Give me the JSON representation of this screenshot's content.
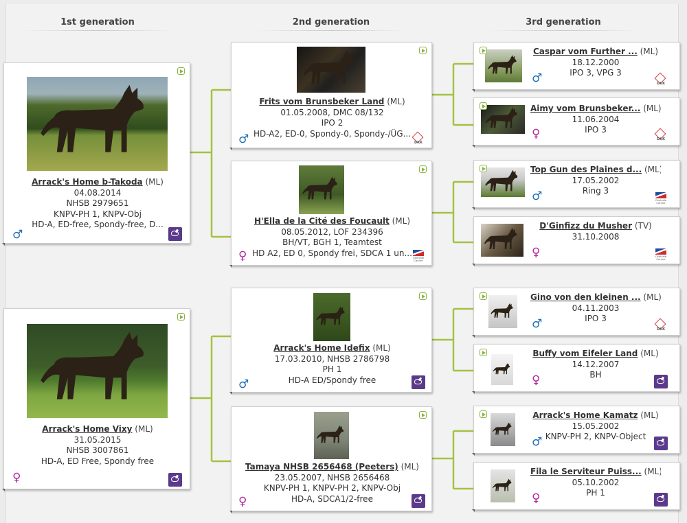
{
  "headers": {
    "gen1": "1st generation",
    "gen2": "2nd generation",
    "gen3": "3rd generation"
  },
  "colors": {
    "connector": "#a3c241",
    "male": "#1d6fb8",
    "female": "#b3269e",
    "knpv_logo": "#5b3a8c"
  },
  "dogs": {
    "g1_0": {
      "name": "Arrack's Home b-Takoda",
      "reg": "(ML)",
      "lines": [
        "04.08.2014",
        "NHSB 2979651",
        "KNPV-PH 1, KNPV-Obj",
        "HD-A, ED-free, Spondy-free, D..."
      ],
      "sex": "male",
      "sex_symbol": "♂",
      "logo": "knpv-logo-icon",
      "photo": "dog-standing-field-photo"
    },
    "g1_1": {
      "name": "Arrack's Home Vixy",
      "reg": "(ML)",
      "lines": [
        "31.05.2015",
        "NHSB 3007861",
        "HD-A, ED Free, Spondy free"
      ],
      "sex": "female",
      "sex_symbol": "♀",
      "logo": "knpv-logo-icon",
      "photo": "dog-standing-lawn-photo"
    },
    "g2_0": {
      "name": "Frits vom Brunsbeker Land",
      "reg": "(ML)",
      "lines": [
        "01.05.2008, DMC 08/132",
        "IPO 2",
        "HD-A2, ED-0, Spondy-0, Spondy-/ÜG..."
      ],
      "sex": "male",
      "sex_symbol": "♂",
      "logo": "dkk-logo-icon",
      "photo": "dog-collage-photo"
    },
    "g2_1": {
      "name": "H'Ella de la Cité des Foucault",
      "reg": "(ML)",
      "lines": [
        "08.05.2012, LOF 234396",
        "BH/VT, BGH 1, Teamtest",
        "HD A2, ED 0, Spondy frei, SDCA 1 un..."
      ],
      "sex": "female",
      "sex_symbol": "♀",
      "logo": "centrale-canine-logo-icon",
      "photo": "dog-with-toy-photo"
    },
    "g2_2": {
      "name": "Arrack's Home Idefix",
      "reg": "(ML)",
      "lines": [
        "17.03.2010, NHSB 2786798",
        "PH 1",
        "HD-A ED/Spondy free"
      ],
      "sex": "male",
      "sex_symbol": "♂",
      "logo": "knpv-logo-icon",
      "photo": "dog-portrait-photo"
    },
    "g2_3": {
      "name": "Tamaya NHSB 2656468 (Peeters)",
      "reg": "(ML)",
      "lines": [
        "23.05.2007, NHSB 2656468",
        "KNPV-PH 1, KNPV-PH 2, KNPV-Obj",
        "HD-A, SDCA1/2-free"
      ],
      "sex": "female",
      "sex_symbol": "♀",
      "logo": "knpv-logo-icon",
      "photo": "dog-sitting-photo"
    },
    "g3_0": {
      "name": "Caspar vom Further ...",
      "reg": "(ML)",
      "lines": [
        "18.12.2000",
        "IPO 3, VPG 3"
      ],
      "sex": "male",
      "sex_symbol": "♂",
      "logo": "dkk-logo-icon",
      "photo": "dog-thumbnail-photo"
    },
    "g3_1": {
      "name": "Aimy vom Brunsbeker...",
      "reg": "(ML)",
      "lines": [
        "11.06.2004",
        "IPO 3"
      ],
      "sex": "female",
      "sex_symbol": "♀",
      "logo": "dkk-logo-icon",
      "photo": "dog-thumbnail-photo"
    },
    "g3_2": {
      "name": "Top Gun des Plaines d...",
      "reg": "(ML)",
      "lines": [
        "17.05.2002",
        "Ring 3"
      ],
      "sex": "male",
      "sex_symbol": "♂",
      "logo": "centrale-canine-logo-icon",
      "photo": "dog-thumbnail-photo"
    },
    "g3_3": {
      "name": "D'Ginfizz du Musher",
      "reg": "(TV)",
      "lines": [
        "31.10.2008"
      ],
      "sex": "female",
      "sex_symbol": "♀",
      "logo": "centrale-canine-logo-icon",
      "photo": "dog-thumbnail-photo"
    },
    "g3_4": {
      "name": "Gino von den kleinen ...",
      "reg": "(ML)",
      "lines": [
        "04.11.2003",
        "IPO 3"
      ],
      "sex": "male",
      "sex_symbol": "♂",
      "logo": "dkk-logo-icon",
      "photo": "dog-thumbnail-photo"
    },
    "g3_5": {
      "name": "Buffy vom Eifeler Land",
      "reg": "(ML)",
      "lines": [
        "14.12.2007",
        "BH"
      ],
      "sex": "female",
      "sex_symbol": "♀",
      "logo": "knpv-logo-icon",
      "photo": "dog-thumbnail-photo"
    },
    "g3_6": {
      "name": "Arrack's Home Kamatz",
      "reg": "(ML)",
      "lines": [
        "15.05.2002",
        "KNPV-PH 2, KNPV-Object"
      ],
      "sex": "male",
      "sex_symbol": "♂",
      "logo": "knpv-logo-icon",
      "photo": "dog-thumbnail-photo"
    },
    "g3_7": {
      "name": "Fila le Serviteur Puiss...",
      "reg": "(ML)",
      "lines": [
        "05.10.2002",
        "PH 1"
      ],
      "sex": "female",
      "sex_symbol": "♀",
      "logo": "knpv-logo-icon",
      "photo": "dog-thumbnail-photo"
    }
  }
}
